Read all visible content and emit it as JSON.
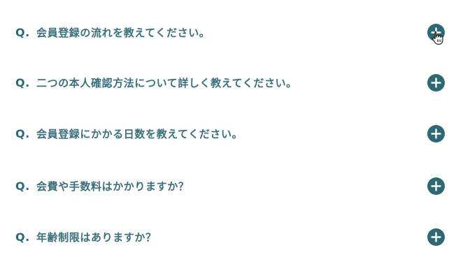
{
  "faq": {
    "q_label": "Q.",
    "items": [
      {
        "question": "会員登録の流れを教えてください。",
        "toggle_icon": "plus-circle-icon"
      },
      {
        "question": "二つの本人確認方法について詳しく教えてください。",
        "toggle_icon": "plus-circle-icon"
      },
      {
        "question": "会員登録にかかる日数を教えてください。",
        "toggle_icon": "plus-circle-icon"
      },
      {
        "question": "会費や手数料はかかりますか？",
        "toggle_icon": "plus-circle-icon"
      },
      {
        "question": "年齢制限はありますか？",
        "toggle_icon": "plus-circle-icon"
      }
    ]
  },
  "colors": {
    "accent": "#2d6873",
    "text": "#3b6f7c",
    "background": "#ffffff"
  },
  "cursor": {
    "icon": "hand-pointer-icon"
  }
}
